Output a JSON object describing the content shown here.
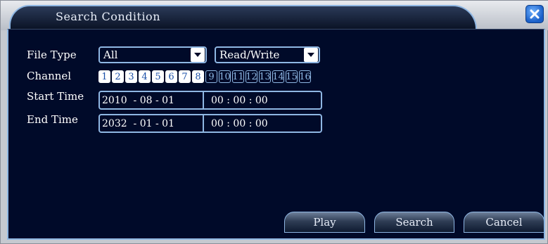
{
  "dialog": {
    "title": "Search Condition"
  },
  "form": {
    "file_type_label": "File Type",
    "file_type_value": "All",
    "access_value": "Read/Write",
    "channel_label": "Channel",
    "channels": [
      {
        "num": "1",
        "selected": true
      },
      {
        "num": "2",
        "selected": true
      },
      {
        "num": "3",
        "selected": true
      },
      {
        "num": "4",
        "selected": true
      },
      {
        "num": "5",
        "selected": true
      },
      {
        "num": "6",
        "selected": true
      },
      {
        "num": "7",
        "selected": true
      },
      {
        "num": "8",
        "selected": true
      },
      {
        "num": "9",
        "selected": false
      },
      {
        "num": "10",
        "selected": false
      },
      {
        "num": "11",
        "selected": false
      },
      {
        "num": "12",
        "selected": false
      },
      {
        "num": "13",
        "selected": false
      },
      {
        "num": "14",
        "selected": false
      },
      {
        "num": "15",
        "selected": false
      },
      {
        "num": "16",
        "selected": false
      }
    ],
    "start_time_label": "Start Time",
    "start_date": "2010  - 08 - 01",
    "start_time": "00 : 00 : 00",
    "end_time_label": "End Time",
    "end_date": "2032  - 01 - 01",
    "end_time": "00 : 00 : 00"
  },
  "buttons": {
    "play": "Play",
    "search": "Search",
    "cancel": "Cancel"
  },
  "icons": {
    "close": "close-icon",
    "dropdown": "chevron-down-icon"
  },
  "colors": {
    "panel_bg": "#000a29",
    "accent_border": "#8fb7e3",
    "channel_on_text": "#1a4fa8"
  }
}
